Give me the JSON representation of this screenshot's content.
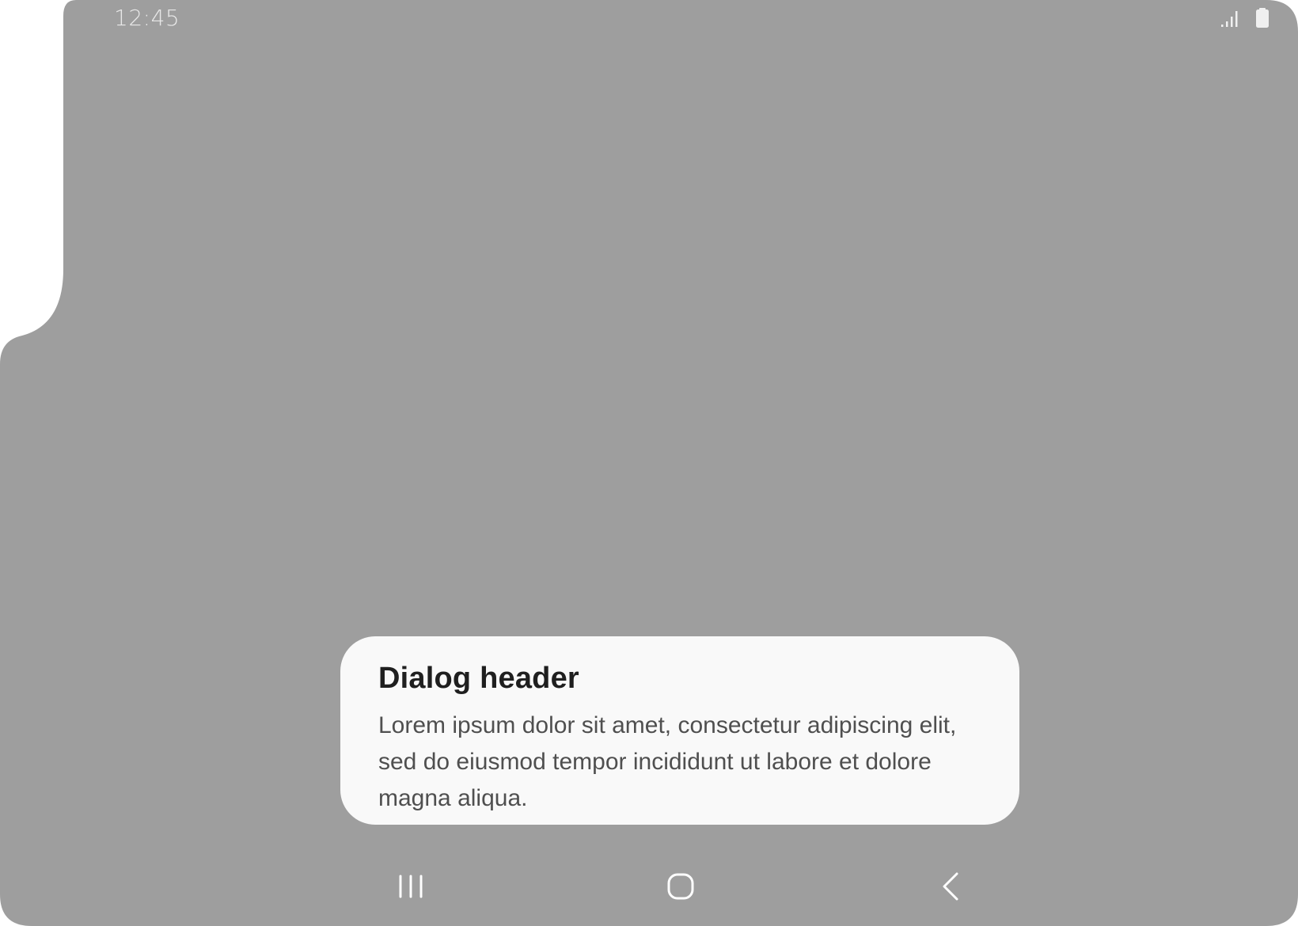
{
  "status_bar": {
    "time": "12:45",
    "icons": [
      "signal-icon",
      "battery-icon"
    ]
  },
  "dialog": {
    "header": "Dialog header",
    "body": "Lorem ipsum dolor sit amet, consectetur adipiscing elit, sed do eiusmod tempor incididunt ut labore et dolore magna aliqua."
  },
  "nav_bar": {
    "buttons": [
      "recent-apps-icon",
      "home-icon",
      "back-icon"
    ]
  },
  "colors": {
    "scrim": "#9e9e9e",
    "dialog_bg": "#f9f9f9",
    "title": "#1f1f1f",
    "body_text": "#4f4f4f",
    "icons": "#ffffff"
  }
}
